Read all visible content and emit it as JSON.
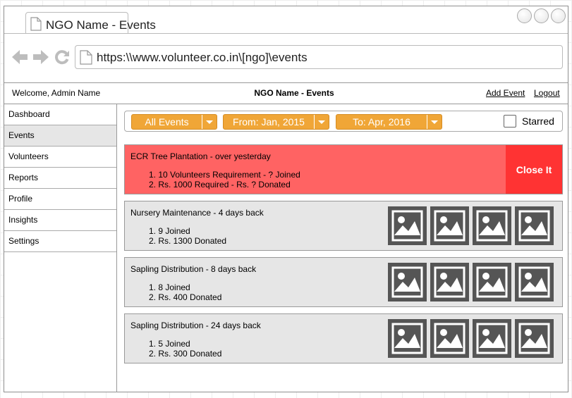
{
  "browser": {
    "tab_title": "NGO Name - Events",
    "url": "https:\\\\www.volunteer.co.in\\[ngo]\\events",
    "icons": [
      "document-icon",
      "back-arrow-icon",
      "forward-arrow-icon",
      "refresh-icon"
    ]
  },
  "header": {
    "welcome": "Welcome, Admin Name",
    "title": "NGO Name - Events",
    "add_event": "Add Event",
    "logout": "Logout"
  },
  "sidebar": {
    "items": [
      {
        "label": "Dashboard",
        "active": false
      },
      {
        "label": "Events",
        "active": true
      },
      {
        "label": "Volunteers",
        "active": false
      },
      {
        "label": "Reports",
        "active": false
      },
      {
        "label": "Profile",
        "active": false
      },
      {
        "label": "Insights",
        "active": false
      },
      {
        "label": "Settings",
        "active": false
      }
    ]
  },
  "filters": {
    "category": "All Events",
    "from": "From: Jan, 2015",
    "to": "To: Apr, 2016",
    "starred_label": "Starred",
    "starred_checked": false
  },
  "events": [
    {
      "title": "ECR Tree Plantation - over yesterday",
      "line1": "1. 10 Volunteers Requirement - ? Joined",
      "line2": "2. Rs. 1000 Required - Rs. ? Donated",
      "action": "Close It"
    },
    {
      "title": "Nursery Maintenance - 4 days back",
      "line1": "1. 9 Joined",
      "line2": "2. Rs. 1300 Donated"
    },
    {
      "title": "Sapling Distribution - 8 days back",
      "line1": "1. 8 Joined",
      "line2": "2. Rs. 400 Donated"
    },
    {
      "title": "Sapling Distribution - 24 days back",
      "line1": "1. 5 Joined",
      "line2": "2. Rs. 300 Donated"
    }
  ],
  "colors": {
    "accent": "#f0a637",
    "urgent": "#ff6363",
    "urgent_button": "#ff3333",
    "card": "#e6e6e6",
    "thumb": "#555555"
  }
}
